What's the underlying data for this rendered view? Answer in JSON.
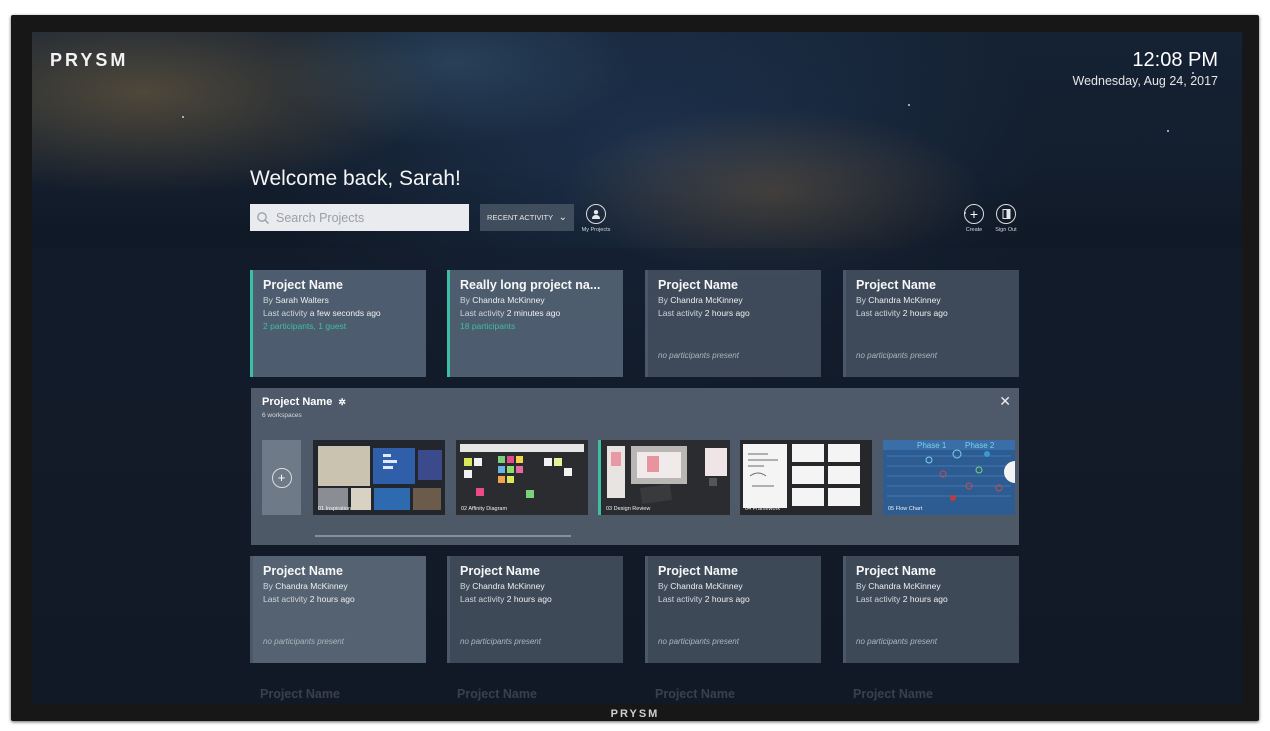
{
  "brand": {
    "logo": "PRYSM",
    "bezel_logo": "PRYSM"
  },
  "clock": {
    "time": "12:08 PM",
    "date": "Wednesday, Aug 24, 2017"
  },
  "welcome": "Welcome back, Sarah!",
  "search": {
    "placeholder": "Search Projects"
  },
  "sort": {
    "label": "RECENT ACTIVITY"
  },
  "actions": {
    "my_projects": "My Projects",
    "create": "Create",
    "sign_out": "Sign Out"
  },
  "row1": [
    {
      "title": "Project Name",
      "by": "By",
      "author": "Sarah Walters",
      "activity_label": "Last activity",
      "activity": "a few seconds ago",
      "participants": "2 participants, 1 guest"
    },
    {
      "title": "Really long project na...",
      "by": "By",
      "author": "Chandra McKinney",
      "activity_label": "Last activity",
      "activity": "2 minutes ago",
      "participants": "18 participants"
    },
    {
      "title": "Project Name",
      "by": "By",
      "author": "Chandra McKinney",
      "activity_label": "Last activity",
      "activity": "2 hours ago",
      "none": "no participants present"
    },
    {
      "title": "Project Name",
      "by": "By",
      "author": "Chandra McKinney",
      "activity_label": "Last activity",
      "activity": "2 hours ago",
      "none": "no participants present"
    }
  ],
  "panel": {
    "title": "Project Name",
    "subtitle": "6 workspaces",
    "workspaces": [
      {
        "label": "01  Inspiration"
      },
      {
        "label": "02  Affinity Diagram"
      },
      {
        "label": "03  Design Review"
      },
      {
        "label": "04  Framework"
      },
      {
        "label": "05  Flow Chart",
        "overlay1": "Phase 1",
        "overlay2": "Phase 2"
      }
    ]
  },
  "row2": [
    {
      "title": "Project Name",
      "by": "By",
      "author": "Chandra McKinney",
      "activity_label": "Last activity",
      "activity": "2 hours ago",
      "none": "no participants present"
    },
    {
      "title": "Project Name",
      "by": "By",
      "author": "Chandra McKinney",
      "activity_label": "Last activity",
      "activity": "2 hours ago",
      "none": "no participants present"
    },
    {
      "title": "Project Name",
      "by": "By",
      "author": "Chandra McKinney",
      "activity_label": "Last activity",
      "activity": "2 hours ago",
      "none": "no participants present"
    },
    {
      "title": "Project Name",
      "by": "By",
      "author": "Chandra McKinney",
      "activity_label": "Last activity",
      "activity": "2 hours ago",
      "none": "no participants present"
    }
  ],
  "row3": [
    "Project Name",
    "Project Name",
    "Project Name",
    "Project Name"
  ],
  "colors": {
    "accent": "#3dbfa6",
    "card": "#465262",
    "search_bg": "#e9ebee"
  }
}
